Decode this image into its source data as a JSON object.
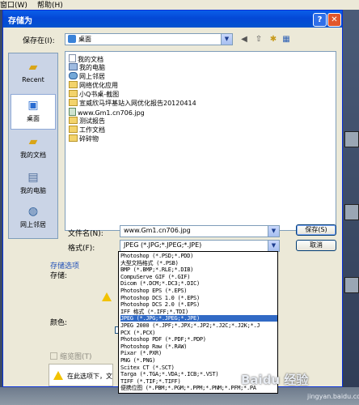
{
  "background_app": {
    "menu": [
      "窗口(W)",
      "帮助(H)"
    ]
  },
  "dialog": {
    "title": "存储为",
    "help_glyph": "?",
    "close_glyph": "✕",
    "save_in_label": "保存在(I):",
    "save_in_value": "桌面",
    "places": [
      {
        "label": "Recent",
        "icon": "recent-folder-icon"
      },
      {
        "label": "桌面",
        "icon": "desktop-icon"
      },
      {
        "label": "我的文档",
        "icon": "my-documents-icon"
      },
      {
        "label": "我的电脑",
        "icon": "my-computer-icon"
      },
      {
        "label": "网上邻居",
        "icon": "network-icon"
      }
    ],
    "files": [
      {
        "name": "我的文档",
        "type": "doc"
      },
      {
        "name": "我的电脑",
        "type": "pc"
      },
      {
        "name": "网上邻居",
        "type": "net"
      },
      {
        "name": "网络优化应用",
        "type": "folder"
      },
      {
        "name": "小Q书桌-截图",
        "type": "folder"
      },
      {
        "name": "宣威欣马坪基站入网优化报告20120414",
        "type": "folder"
      },
      {
        "name": "www.Gm1.cn706.jpg",
        "type": "img"
      },
      {
        "name": "测试报告",
        "type": "folder"
      },
      {
        "name": "工作文档",
        "type": "folder"
      },
      {
        "name": "碎碎物",
        "type": "folder"
      }
    ],
    "filename_label": "文件名(N):",
    "filename_value": "www.Gm1.cn706.jpg",
    "format_label": "格式(F):",
    "format_value": "JPEG (*.JPG;*.JPEG;*.JPE)",
    "save_button": "保存(S)",
    "cancel_button": "取消",
    "save_options_title": "存储选项",
    "save_label": "存储:",
    "color_label": "颜色:",
    "thumbnail_label": "缩览图(T)",
    "warning_text": "在此选项下，文"
  },
  "format_options": [
    "Photoshop (*.PSD;*.PDD)",
    "大型文档格式 (*.PSB)",
    "BMP (*.BMP;*.RLE;*.DIB)",
    "CompuServe GIF (*.GIF)",
    "Dicom (*.DCM;*.DC3;*.DIC)",
    "Photoshop EPS (*.EPS)",
    "Photoshop DCS 1.0 (*.EPS)",
    "Photoshop DCS 2.0 (*.EPS)",
    "IFF 格式 (*.IFF;*.TDI)",
    "JPEG (*.JPG;*.JPEG;*.JPE)",
    "JPEG 2000 (*.JPF;*.JPX;*.JP2;*.J2C;*.J2K;*.J",
    "PCX (*.PCX)",
    "Photoshop PDF (*.PDF;*.PDP)",
    "Photoshop Raw (*.RAW)",
    "Pixar (*.PXR)",
    "PNG (*.PNG)",
    "Scitex CT (*.SCT)",
    "Targa (*.TGA;*.VDA;*.ICB;*.VST)",
    "TIFF (*.TIF;*.TIFF)",
    "便携位图 (*.PBM;*.PGM;*.PPM;*.PNM;*.PFM;*.PA"
  ],
  "selected_format_index": 9,
  "watermark": {
    "logo": "Baidu 经验",
    "url": "jingyan.baidu.com"
  }
}
